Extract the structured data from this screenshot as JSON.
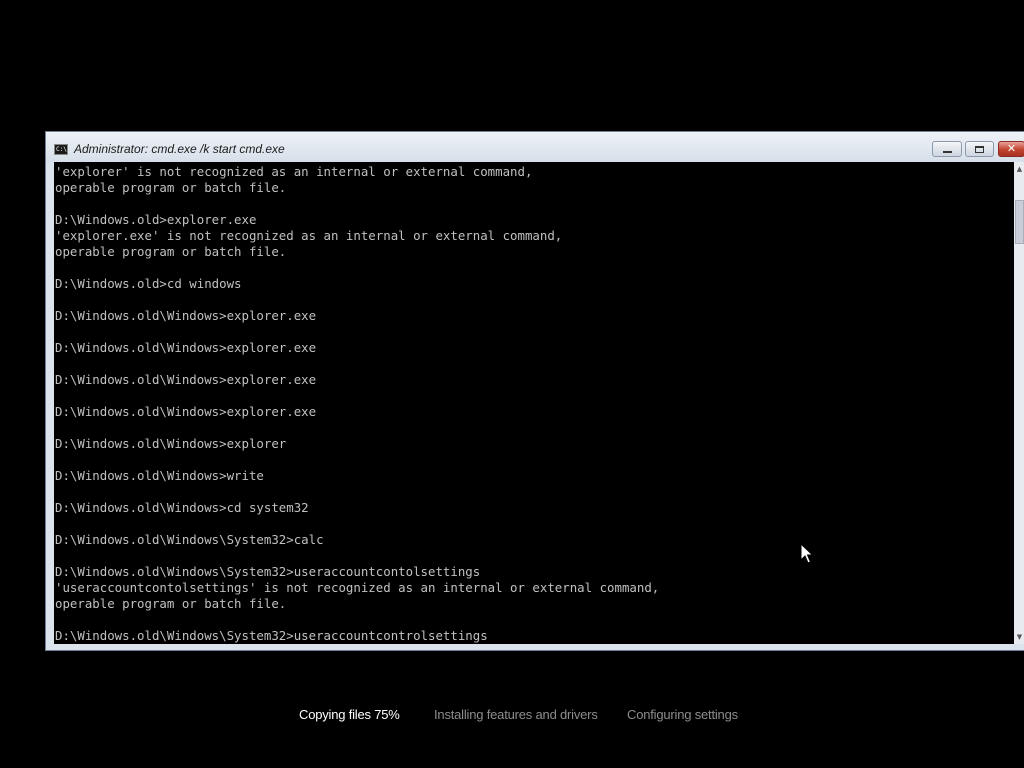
{
  "window": {
    "title": "Administrator: cmd.exe /k start cmd.exe",
    "icon": "console-icon",
    "buttons": {
      "minimize": "minimize-icon",
      "maximize": "maximize-icon",
      "close": "close-icon"
    }
  },
  "console": {
    "lines": [
      "'explorer' is not recognized as an internal or external command,",
      "operable program or batch file.",
      "",
      "D:\\Windows.old>explorer.exe",
      "'explorer.exe' is not recognized as an internal or external command,",
      "operable program or batch file.",
      "",
      "D:\\Windows.old>cd windows",
      "",
      "D:\\Windows.old\\Windows>explorer.exe",
      "",
      "D:\\Windows.old\\Windows>explorer.exe",
      "",
      "D:\\Windows.old\\Windows>explorer.exe",
      "",
      "D:\\Windows.old\\Windows>explorer.exe",
      "",
      "D:\\Windows.old\\Windows>explorer",
      "",
      "D:\\Windows.old\\Windows>write",
      "",
      "D:\\Windows.old\\Windows>cd system32",
      "",
      "D:\\Windows.old\\Windows\\System32>calc",
      "",
      "D:\\Windows.old\\Windows\\System32>useraccountcontolsettings",
      "'useraccountcontolsettings' is not recognized as an internal or external command,",
      "operable program or batch file.",
      "",
      "D:\\Windows.old\\Windows\\System32>useraccountcontrolsettings"
    ]
  },
  "setup": {
    "steps": [
      {
        "label": "Copying files 75%",
        "active": true
      },
      {
        "label": "Installing features and drivers",
        "active": false
      },
      {
        "label": "Configuring settings",
        "active": false
      }
    ]
  },
  "colors": {
    "desktop": "#000000",
    "console_bg": "#000000",
    "console_text": "#c0c0c0",
    "active_step": "#ffffff",
    "inactive_step": "#8c8c8c"
  }
}
